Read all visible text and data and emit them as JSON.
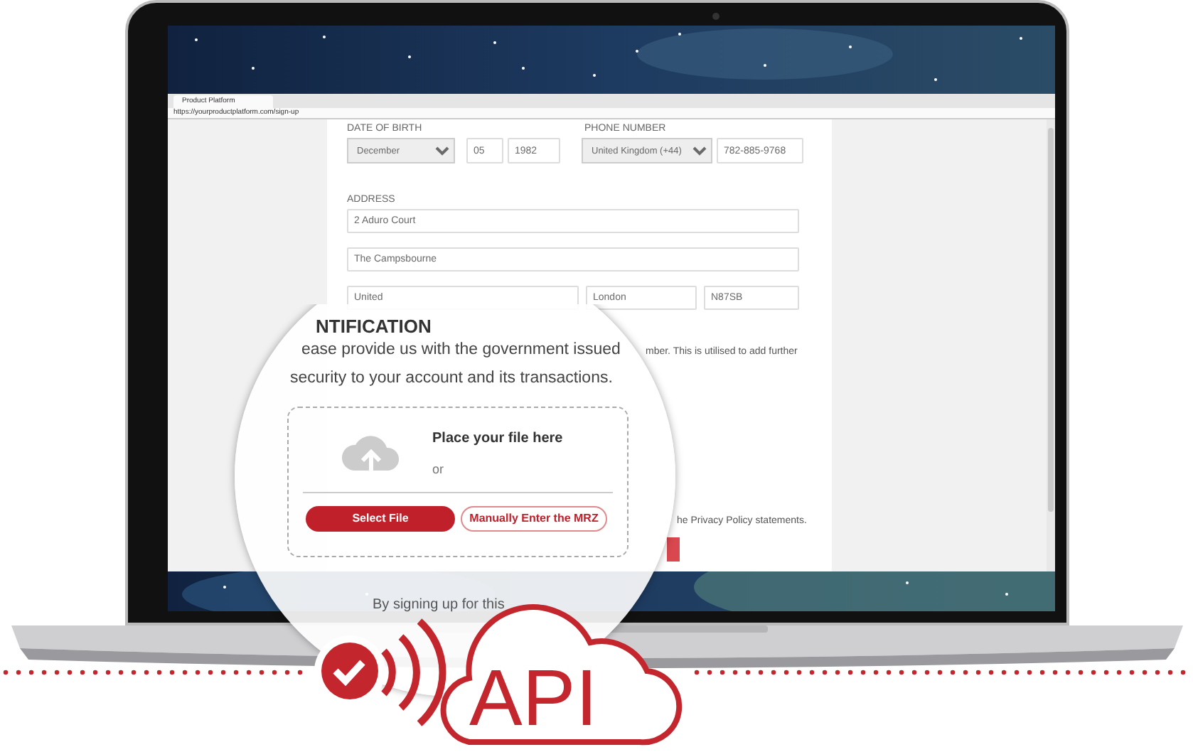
{
  "browser": {
    "tab_title": "Product Platform",
    "url": "https://yourproductplatform.com/sign-up"
  },
  "form": {
    "dob_label": "DATE OF BIRTH",
    "dob_month": "December",
    "dob_day": "05",
    "dob_year": "1982",
    "phone_label": "PHONE NUMBER",
    "phone_country": "United Kingdom (+44)",
    "phone_number": "782-885-9768",
    "address_label": "ADDRESS",
    "address_rows": [
      [
        "2 Aduro Court"
      ],
      [
        "The Campsbourne"
      ],
      [
        "United",
        "London",
        "N87SB"
      ]
    ],
    "sentence_rest": "mber. This is utilised to add further",
    "privacy": "he Privacy Policy statements."
  },
  "lens": {
    "heading": "NTIFICATION",
    "text_1": "ease provide us with the government issued",
    "text_2": "security to your account and its transactions.",
    "drop_title": "Place your file here",
    "drop_or": "or",
    "buttons": [
      "Select File",
      "Manually Enter the MRZ"
    ],
    "footer": "By signing up for this"
  },
  "logo": {
    "text": "API"
  }
}
